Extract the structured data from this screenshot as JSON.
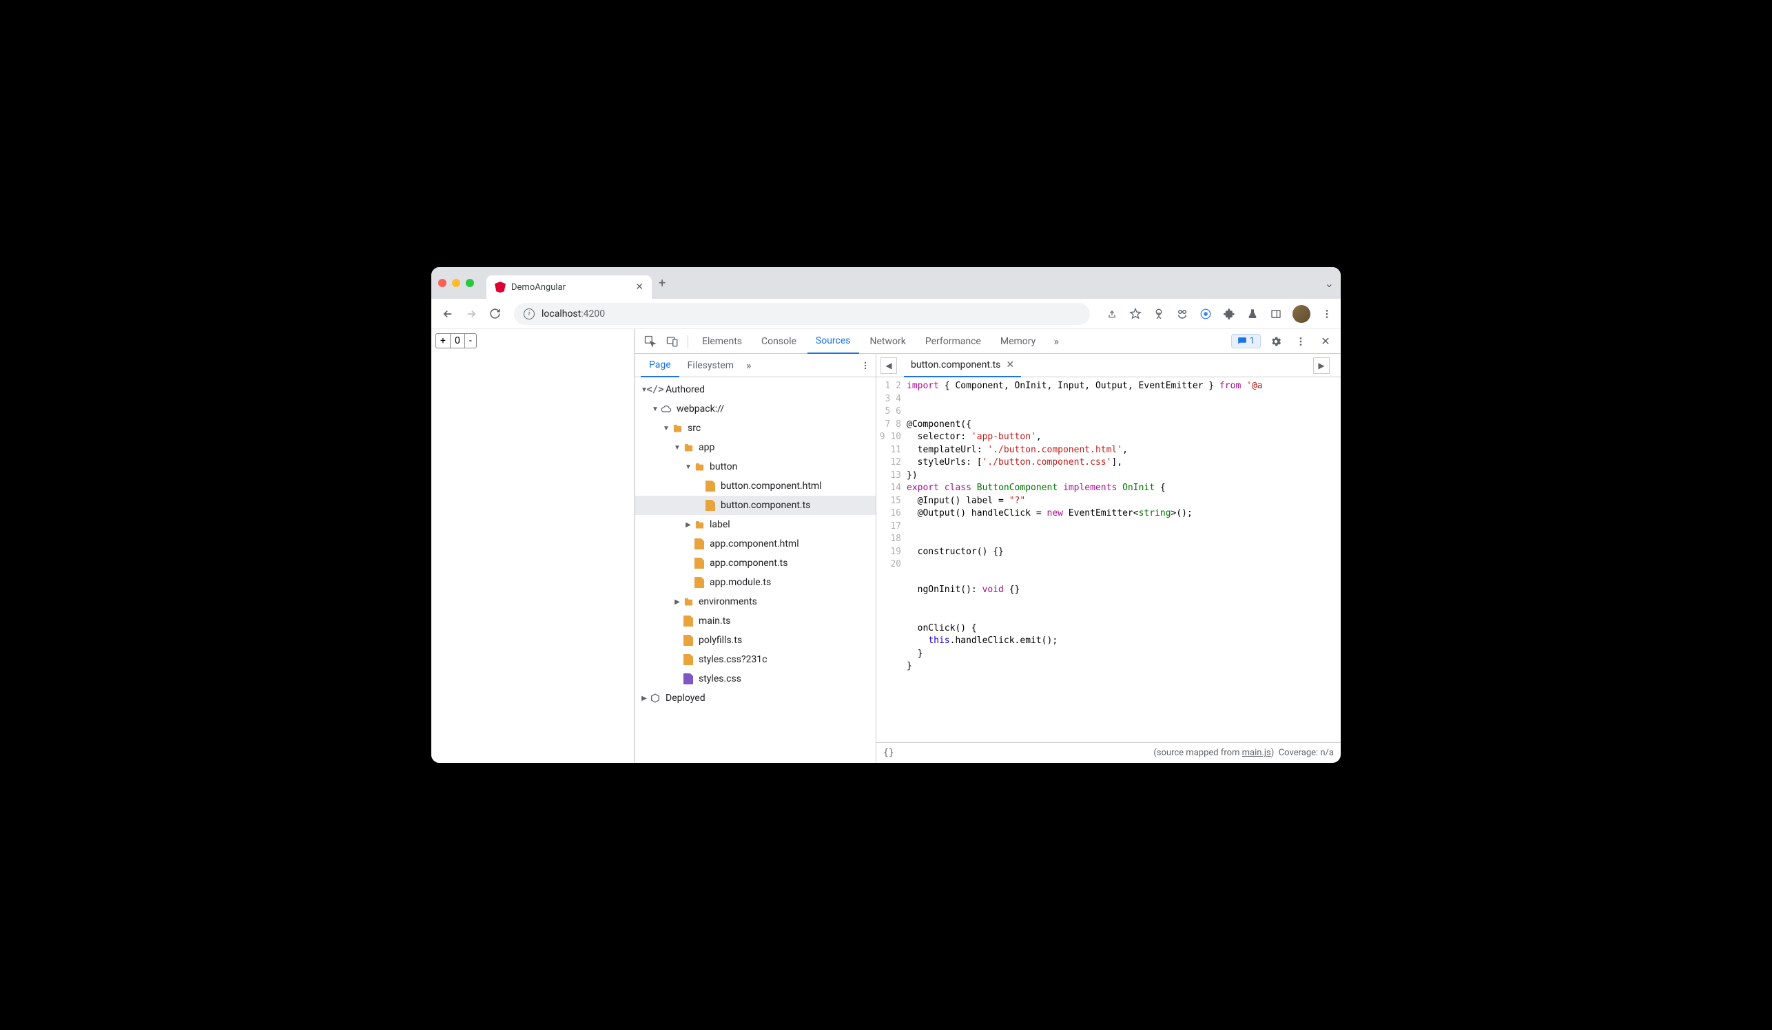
{
  "browser": {
    "tab_title": "DemoAngular",
    "url_host": "localhost",
    "url_port": ":4200"
  },
  "page": {
    "plus": "+",
    "zero": "0",
    "minus": "-"
  },
  "devtools": {
    "tabs": [
      "Elements",
      "Console",
      "Sources",
      "Network",
      "Performance",
      "Memory"
    ],
    "active_tab": "Sources",
    "issues_count": "1"
  },
  "sources": {
    "nav_tabs": [
      "Page",
      "Filesystem"
    ],
    "active_nav": "Page",
    "editor_tab": "button.component.ts",
    "tree": {
      "authored": "Authored",
      "webpack": "webpack://",
      "src": "src",
      "app": "app",
      "button": "button",
      "button_html": "button.component.html",
      "button_ts": "button.component.ts",
      "label": "label",
      "app_html": "app.component.html",
      "app_ts": "app.component.ts",
      "app_module": "app.module.ts",
      "environments": "environments",
      "main_ts": "main.ts",
      "polyfills": "polyfills.ts",
      "styles_q": "styles.css?231c",
      "styles": "styles.css",
      "deployed": "Deployed"
    }
  },
  "code": {
    "line_count": 20,
    "tokens": {
      "l1_import": "import",
      "l1_rest": " { Component, OnInit, Input, Output, EventEmitter } ",
      "l1_from": "from",
      "l1_pkg": "'@a",
      "l3": "@Component({",
      "l4_k": "  selector: ",
      "l4_v": "'app-button'",
      "l4_e": ",",
      "l5_k": "  templateUrl: ",
      "l5_v": "'./button.component.html'",
      "l5_e": ",",
      "l6_k": "  styleUrls: [",
      "l6_v": "'./button.component.css'",
      "l6_e": "],",
      "l7": "})",
      "l8_export": "export",
      "l8_class": "class",
      "l8_name": "ButtonComponent",
      "l8_impl": "implements",
      "l8_oninit": "OnInit",
      "l8_brace": " {",
      "l9_a": "  @Input() label = ",
      "l9_v": "\"?\"",
      "l10_a": "  @Output() handleClick = ",
      "l10_new": "new",
      "l10_b": " EventEmitter<",
      "l10_str": "string",
      "l10_c": ">();",
      "l12": "  constructor() {}",
      "l14_a": "  ngOnInit(): ",
      "l14_void": "void",
      "l14_b": " {}",
      "l16": "  onClick() {",
      "l17_a": "    ",
      "l17_this": "this",
      "l17_b": ".handleClick.emit();",
      "l18": "  }",
      "l19": "}"
    }
  },
  "footer": {
    "braces": "{}",
    "mapped_pre": "(source mapped from ",
    "mapped_link": "main.js",
    "mapped_post": ")",
    "coverage": "Coverage: n/a"
  }
}
